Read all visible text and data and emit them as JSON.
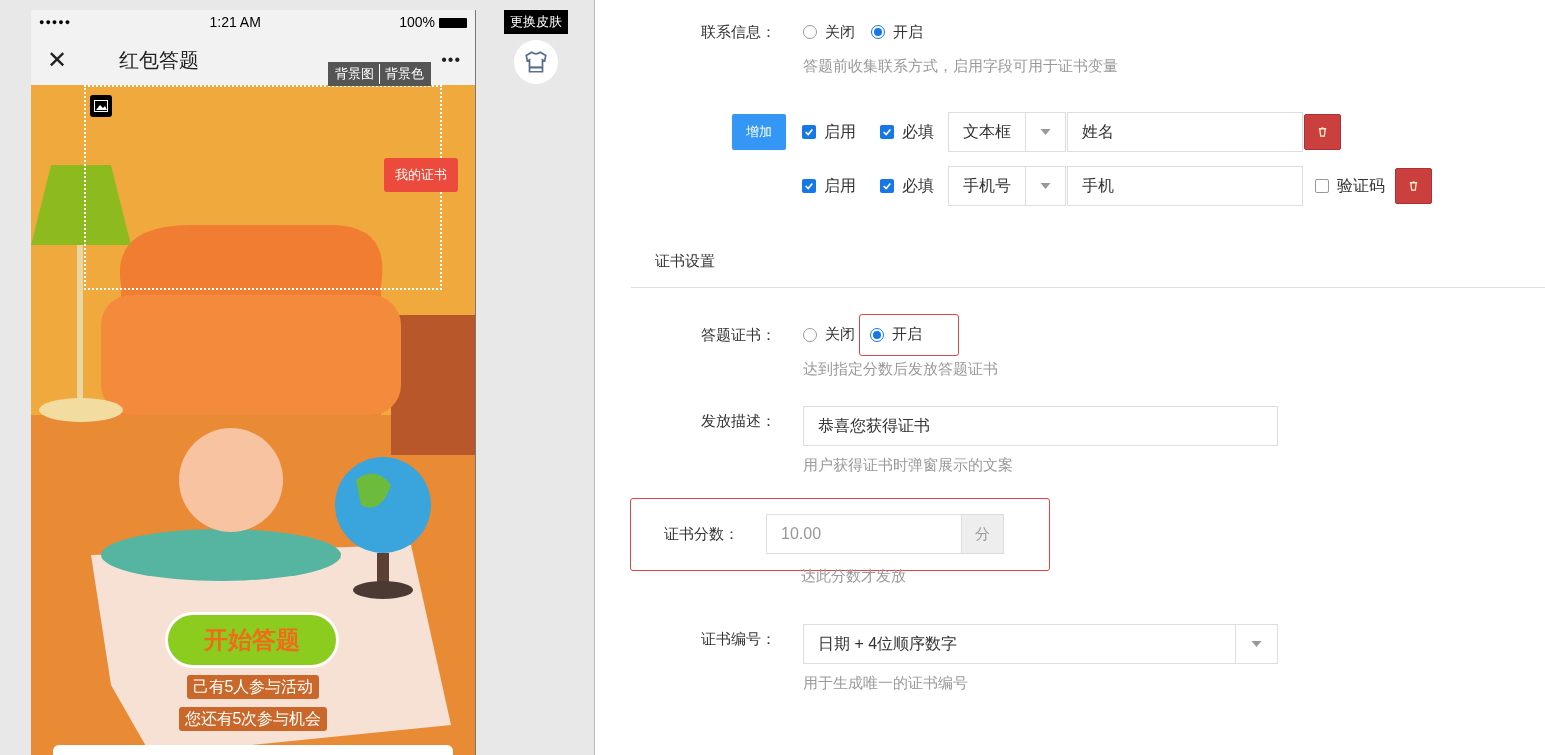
{
  "phone": {
    "status": {
      "signal": "●●●●●",
      "time": "1:21 AM",
      "battery": "100%"
    },
    "nav": {
      "close": "✕",
      "title": "红包答题",
      "more": "•••"
    },
    "bg_buttons": [
      "背景图",
      "背景色"
    ],
    "cert_button": "我的证书",
    "start_button": "开始答题",
    "stats": [
      "己有5人参与活动",
      "您还有5次参与机会"
    ]
  },
  "skin_button": "更换皮肤",
  "contact": {
    "label": "联系信息：",
    "options": [
      {
        "label": "关闭",
        "selected": false
      },
      {
        "label": "开启",
        "selected": true
      }
    ],
    "hint": "答题前收集联系方式，启用字段可用于证书变量"
  },
  "add_button": "增加",
  "fields": [
    {
      "enabled": {
        "label": "启用",
        "checked": true
      },
      "required": {
        "label": "必填",
        "checked": true
      },
      "type": "文本框",
      "name": "姓名"
    },
    {
      "enabled": {
        "label": "启用",
        "checked": true
      },
      "required": {
        "label": "必填",
        "checked": true
      },
      "type": "手机号",
      "name": "手机",
      "verify": {
        "label": "验证码",
        "checked": false
      }
    }
  ],
  "section_title": "证书设置",
  "cert": {
    "label": "答题证书：",
    "options": [
      {
        "label": "关闭",
        "selected": false
      },
      {
        "label": "开启",
        "selected": true
      }
    ],
    "hint": "达到指定分数后发放答题证书",
    "highlighted": true
  },
  "description": {
    "label": "发放描述：",
    "value": "恭喜您获得证书",
    "hint": "用户获得证书时弹窗展示的文案"
  },
  "score": {
    "label": "证书分数：",
    "placeholder": "10.00",
    "unit": "分",
    "hint": "达此分数才发放",
    "highlighted": true
  },
  "number": {
    "label": "证书编号：",
    "value": "日期 + 4位顺序数字",
    "hint": "用于生成唯一的证书编号"
  }
}
